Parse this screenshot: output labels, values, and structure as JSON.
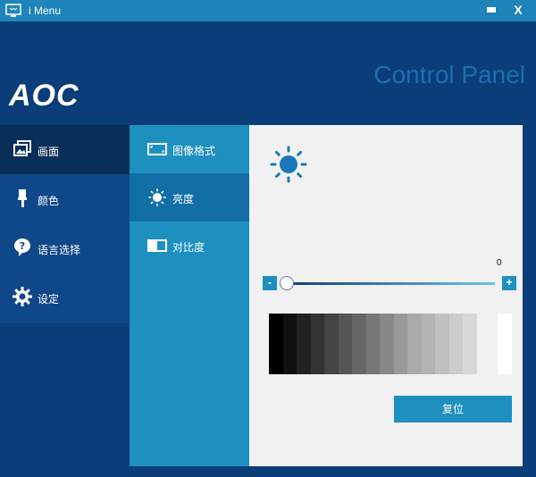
{
  "window": {
    "title": "i Menu",
    "minimize_label": "",
    "close_label": "X"
  },
  "header": {
    "logo": "AOC",
    "title": "Control Panel"
  },
  "sidebar": {
    "items": [
      {
        "label": "画面",
        "icon": "picture-icon",
        "active": true
      },
      {
        "label": "颜色",
        "icon": "color-brush-icon",
        "active": false
      },
      {
        "label": "语言选择",
        "icon": "language-help-icon",
        "active": false
      },
      {
        "label": "设定",
        "icon": "gear-icon",
        "active": false
      }
    ]
  },
  "submenu": {
    "items": [
      {
        "label": "图像格式",
        "icon": "aspect-ratio-icon",
        "active": false
      },
      {
        "label": "亮度",
        "icon": "brightness-icon",
        "active": true
      },
      {
        "label": "对比度",
        "icon": "contrast-icon",
        "active": false
      }
    ]
  },
  "content": {
    "brightness_value": "0",
    "minus_label": "-",
    "plus_label": "+",
    "reset_label": "复位"
  },
  "colors": {
    "accent": "#1e90c0",
    "background": "#0b3d78",
    "sidebar_active": "#0a2e5a",
    "submenu_active": "#116fa6",
    "panel": "#f1f1f1",
    "sun": "#1a78b8"
  }
}
